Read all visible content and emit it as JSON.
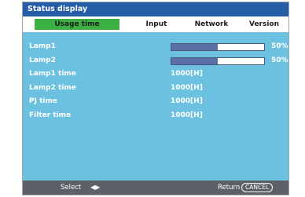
{
  "window": {
    "title": "Status display"
  },
  "tabs": [
    {
      "label": "Usage time",
      "active": true
    },
    {
      "label": "Input",
      "active": false
    },
    {
      "label": "Network",
      "active": false
    },
    {
      "label": "Version",
      "active": false
    }
  ],
  "rows": {
    "lamp1": {
      "label": "Lamp1",
      "percent_text": "50%",
      "level": 0.5
    },
    "lamp2": {
      "label": "Lamp2",
      "percent_text": "50%",
      "level": 0.5
    },
    "lamp1_time": {
      "label": "Lamp1 time",
      "value": "1000[H]"
    },
    "lamp2_time": {
      "label": "Lamp2 time",
      "value": "1000[H]"
    },
    "pj_time": {
      "label": "PJ time",
      "value": "1000[H]"
    },
    "filter_time": {
      "label": "Filter time",
      "value": "1000[H]"
    }
  },
  "footer": {
    "select_label": "Select",
    "select_arrows": "◀▶",
    "return_label": "Return",
    "cancel_label": "CANCEL"
  },
  "colors": {
    "background": "#6cc0e0",
    "titlebar": "#255da6",
    "active_tab": "#3cb043",
    "bar_fill": "#5a6fa6",
    "footer": "#5d6066"
  }
}
